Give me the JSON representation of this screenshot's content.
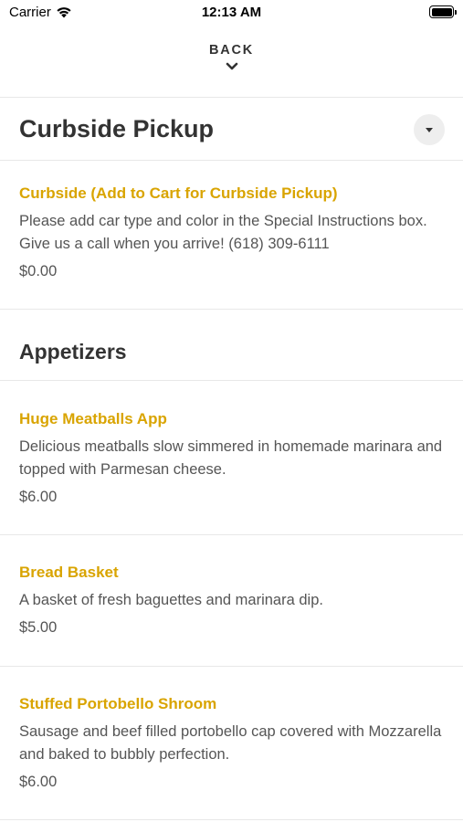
{
  "status_bar": {
    "carrier": "Carrier",
    "time": "12:13 AM"
  },
  "nav": {
    "back_label": "BACK"
  },
  "sections": [
    {
      "title": "Curbside Pickup",
      "items": [
        {
          "name": "Curbside (Add to Cart for Curbside Pickup)",
          "description": "Please add car type and color in the Special Instructions box. Give us a call when you arrive! (618) 309-6111",
          "price": "$0.00"
        }
      ]
    },
    {
      "title": "Appetizers",
      "items": [
        {
          "name": "Huge Meatballs App",
          "description": "Delicious meatballs slow simmered in homemade marinara and topped with Parmesan cheese.",
          "price": "$6.00"
        },
        {
          "name": "Bread Basket",
          "description": "A basket of fresh baguettes and marinara dip.",
          "price": "$5.00"
        },
        {
          "name": "Stuffed Portobello Shroom",
          "description": "Sausage and beef filled portobello cap covered with Mozzarella and baked to bubbly perfection.",
          "price": "$6.00"
        }
      ]
    }
  ],
  "colors": {
    "accent": "#d9a400",
    "text": "#333333",
    "muted": "#555555",
    "divider": "#e8e8e8"
  }
}
